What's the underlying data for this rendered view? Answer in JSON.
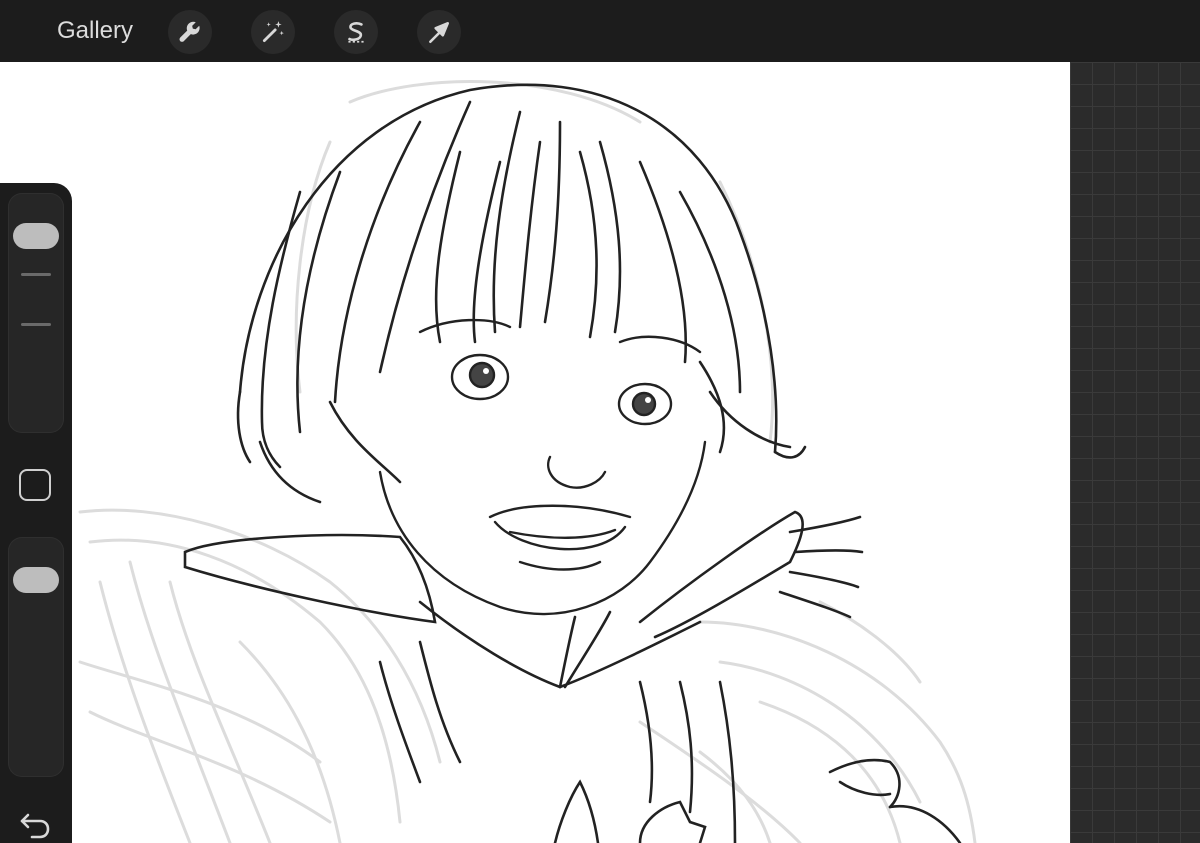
{
  "app": {
    "gallery_label": "Gallery"
  },
  "toolbar": {
    "icons": [
      "wrench-icon",
      "magic-wand-icon",
      "selection-s-icon",
      "arrow-icon"
    ]
  },
  "sidebar": {
    "brush_size_level": 0.08,
    "opacity_level": 0.08,
    "icons": [
      "square-icon",
      "undo-icon"
    ]
  },
  "colors": {
    "topbar": "#1c1c1c",
    "canvas": "#ffffff",
    "workspace": "#2b2b2b",
    "ui_text": "#dcdcdc"
  }
}
